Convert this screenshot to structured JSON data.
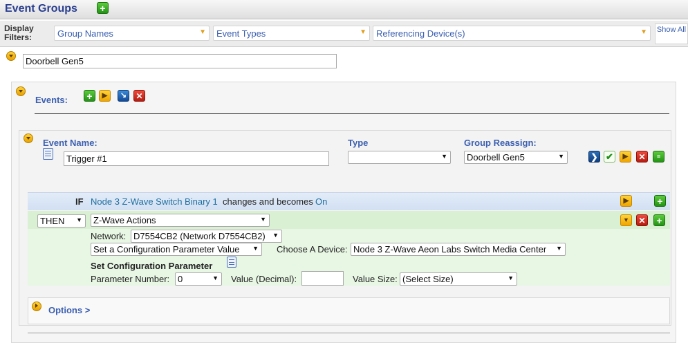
{
  "header": {
    "title": "Event Groups",
    "add_icon": "plus-icon"
  },
  "filters": {
    "label": "Display Filters:",
    "group_names": "Group Names",
    "event_types": "Event Types",
    "referencing_devices": "Referencing Device(s)",
    "show_all": "Show All"
  },
  "group": {
    "name": "Doorbell Gen5"
  },
  "events_section": {
    "label": "Events:"
  },
  "event": {
    "name_label": "Event Name:",
    "name_value": "Trigger #1",
    "type_label": "Type",
    "type_value": "",
    "reassign_label": "Group Reassign:",
    "reassign_value": "Doorbell Gen5"
  },
  "condition": {
    "if": "IF",
    "device": "Node 3 Z-Wave Switch Binary 1",
    "clause": "changes and becomes",
    "value": "On"
  },
  "action": {
    "then": "THEN",
    "action_type": "Z-Wave Actions",
    "network_label": "Network:",
    "network_value": "D7554CB2 (Network D7554CB2)",
    "command": "Set a Configuration Parameter Value",
    "choose_device_label": "Choose A Device:",
    "device_value": "Node 3 Z-Wave Aeon Labs Switch Media Center",
    "section_title": "Set Configuration Parameter",
    "param_number_label": "Parameter Number:",
    "param_number_value": "0",
    "value_label": "Value (Decimal):",
    "value_value": "",
    "size_label": "Value Size:",
    "size_value": "(Select Size)"
  },
  "options": {
    "label": "Options >"
  },
  "colors": {
    "accent_blue": "#3b5fb0",
    "title_blue": "#2a3f8f",
    "green": "#239414",
    "yellow": "#f0a500",
    "red": "#b51c10"
  }
}
